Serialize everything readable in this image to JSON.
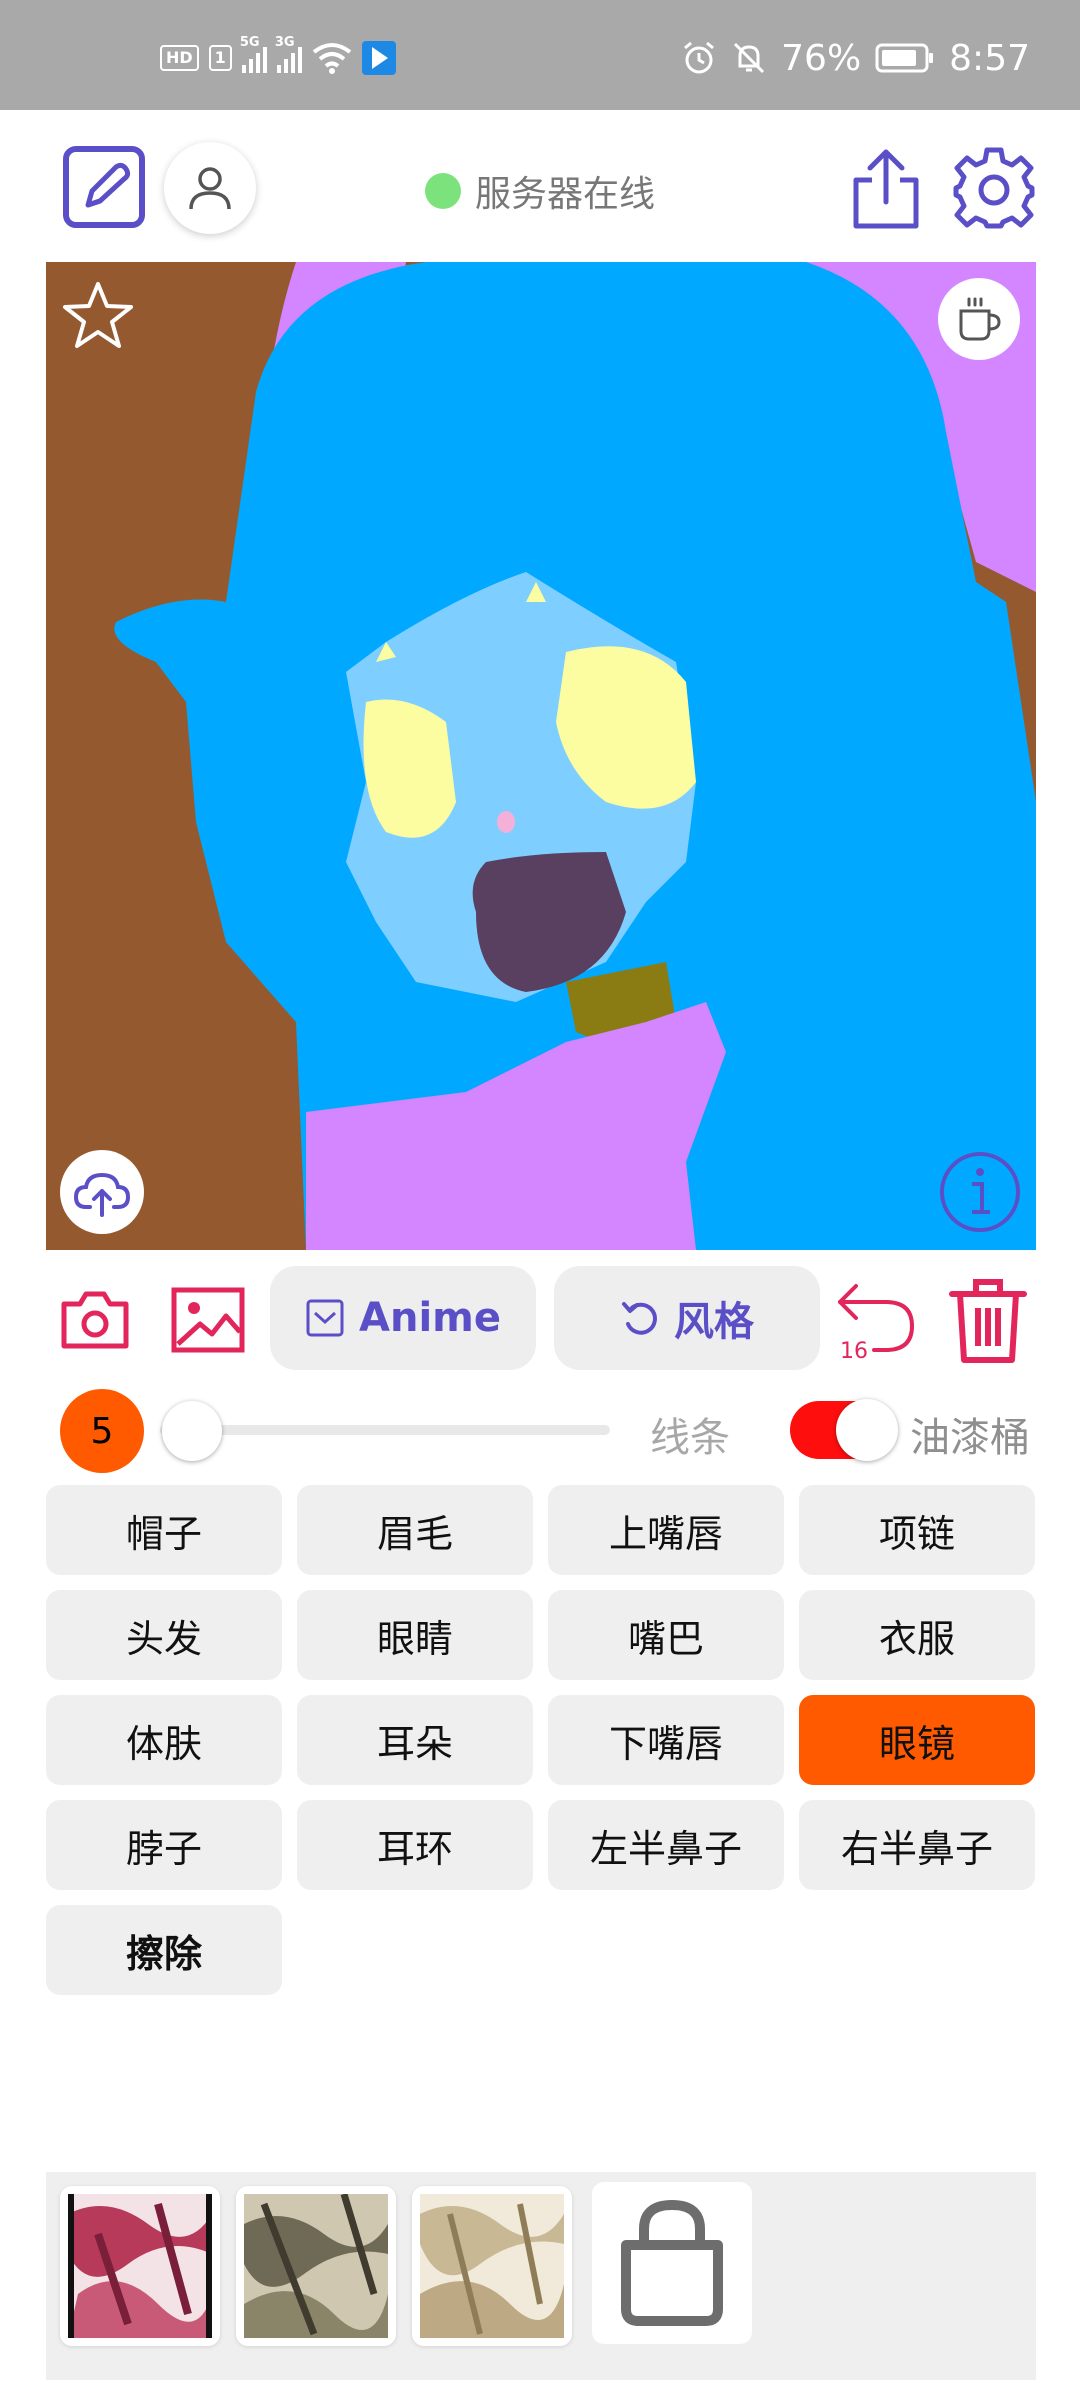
{
  "status_bar": {
    "hd_badge": "HD",
    "sim1": "1",
    "net1": "5G",
    "net2": "3G",
    "battery": "76%",
    "time": "8:57"
  },
  "toolbar": {
    "server_status": "服务器在线",
    "status_color": "#7ce37c"
  },
  "icons": {
    "edit": "edit-icon",
    "user": "user-icon",
    "share": "share-icon",
    "settings": "gear-icon",
    "favorite": "star-icon",
    "coffee": "coffee-cup-icon",
    "upload": "cloud-upload-icon",
    "info": "info-icon",
    "camera": "camera-icon",
    "gallery": "image-icon",
    "undo": "undo-icon",
    "delete": "trash-icon",
    "bag": "shopping-bag-icon"
  },
  "tools": {
    "model_label": "Anime",
    "style_label": "风格",
    "undo_count": "16"
  },
  "brush": {
    "size": "5",
    "size_fraction": 0.0,
    "line_label": "线条",
    "bucket_label": "油漆桶",
    "bucket_enabled": true
  },
  "parts": [
    {
      "label": "帽子",
      "active": false
    },
    {
      "label": "眉毛",
      "active": false
    },
    {
      "label": "上嘴唇",
      "active": false
    },
    {
      "label": "项链",
      "active": false
    },
    {
      "label": "头发",
      "active": false
    },
    {
      "label": "眼睛",
      "active": false
    },
    {
      "label": "嘴巴",
      "active": false
    },
    {
      "label": "衣服",
      "active": false
    },
    {
      "label": "体肤",
      "active": false
    },
    {
      "label": "耳朵",
      "active": false
    },
    {
      "label": "下嘴唇",
      "active": false
    },
    {
      "label": "眼镜",
      "active": true
    },
    {
      "label": "脖子",
      "active": false
    },
    {
      "label": "耳环",
      "active": false
    },
    {
      "label": "左半鼻子",
      "active": false
    },
    {
      "label": "右半鼻子",
      "active": false
    },
    {
      "label": "擦除",
      "active": false
    }
  ],
  "colors": {
    "accent_red": "#e2265b",
    "accent_purple": "#5b4fc8",
    "active_orange": "#ff5a00",
    "background": "#95592f",
    "hair": "#00a9ff",
    "skin": "#7ecfff",
    "eyes": "#fbfda0",
    "mouth": "#5a4060",
    "accessory": "#d386ff",
    "neck": "#8a7b12"
  }
}
